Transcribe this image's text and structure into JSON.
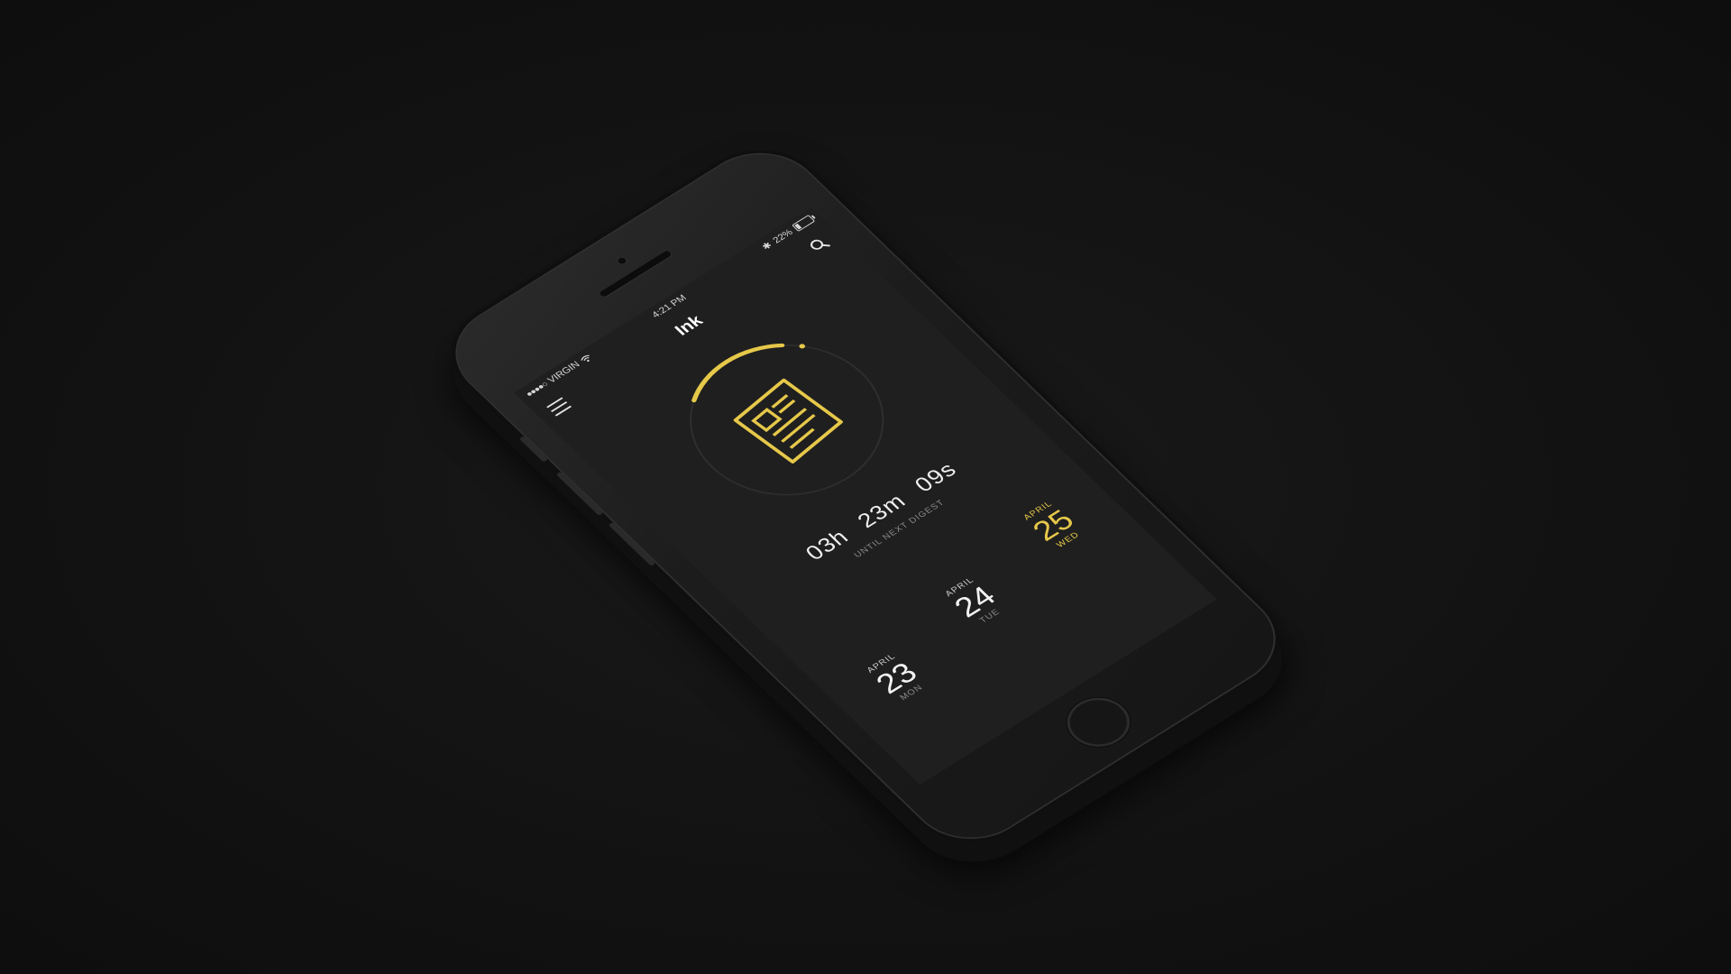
{
  "status_bar": {
    "carrier": "VIRGIN",
    "signal_dots": "●●●●○",
    "time": "4:21 PM",
    "bluetooth": "✱",
    "battery_percent": "22%",
    "battery_level": 0.22
  },
  "nav": {
    "title": "Ink",
    "menu_icon": "hamburger-menu-icon",
    "search_icon": "search-icon"
  },
  "timer": {
    "progress_fraction": 0.2,
    "icon": "newspaper-icon",
    "hours": "03",
    "hours_unit": "h",
    "minutes": "23",
    "minutes_unit": "m",
    "seconds": "09",
    "seconds_unit": "s",
    "caption": "UNTIL NEXT DIGEST"
  },
  "dates": [
    {
      "month": "APRIL",
      "day": "23",
      "weekday": "MON",
      "active": false
    },
    {
      "month": "APRIL",
      "day": "24",
      "weekday": "TUE",
      "active": false
    },
    {
      "month": "APRIL",
      "day": "25",
      "weekday": "WED",
      "active": true
    }
  ],
  "colors": {
    "accent": "#e6c84a",
    "background": "#141414",
    "screen": "#1f1f1f",
    "ring_track": "#2e2e2e"
  }
}
